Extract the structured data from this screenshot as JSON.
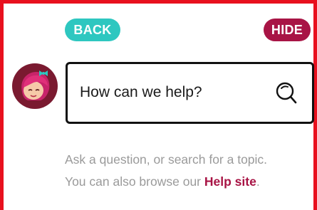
{
  "buttons": {
    "back_label": "BACK",
    "hide_label": "HIDE"
  },
  "search": {
    "placeholder": "How can we help?"
  },
  "help": {
    "line1": "Ask a question, or search for a topic.",
    "line2_prefix": "You can also browse our ",
    "link_label": "Help site",
    "line2_suffix": "."
  },
  "colors": {
    "frame": "#e8101e",
    "back_button": "#2ec7c0",
    "hide_button": "#a81445",
    "link": "#a81445",
    "muted_text": "#9a9a9a"
  },
  "icons": {
    "search": "search-icon",
    "avatar": "assistant-avatar"
  }
}
